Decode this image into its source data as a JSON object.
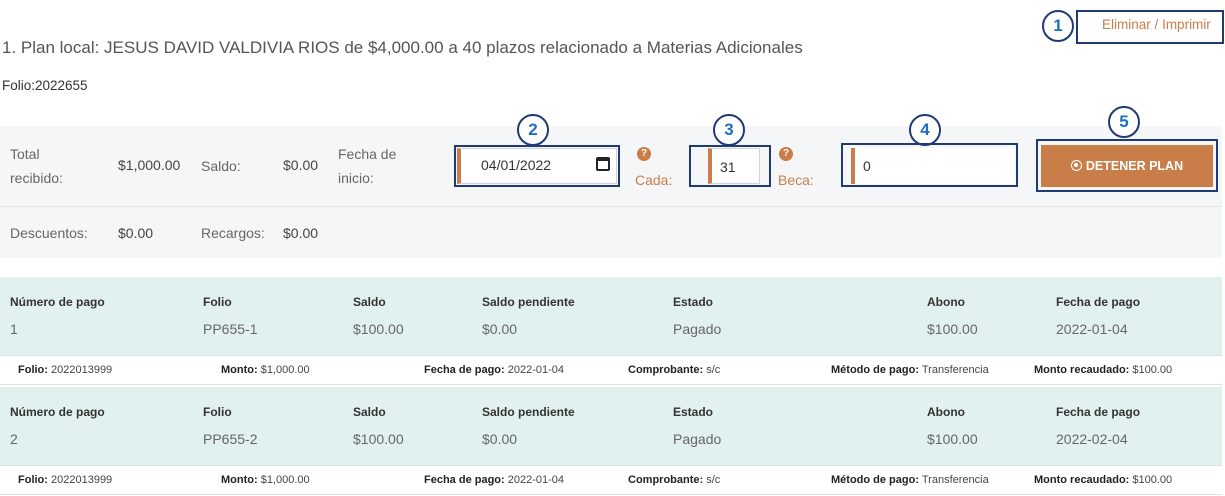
{
  "actions": {
    "delete_label": "Eliminar",
    "separator": "/",
    "print_label": "Imprimir"
  },
  "markers": [
    "1",
    "2",
    "3",
    "4",
    "5"
  ],
  "plan": {
    "title": "1. Plan local: JESUS DAVID VALDIVIA RIOS de $4,000.00 a 40 plazos relacionado a Materias Adicionales",
    "folio": "Folio:2022655"
  },
  "summary": {
    "total_label_1": "Total",
    "total_label_2": "recibido:",
    "total_value": "$1,000.00",
    "saldo_label": "Saldo:",
    "saldo_value": "$0.00",
    "fecha_label_1": "Fecha de",
    "fecha_label_2": "inicio:",
    "fecha_value": "04/01/2022",
    "cada_label": "Cada:",
    "cada_value": "31",
    "beca_label": "Beca:",
    "beca_value": "0",
    "help_glyph": "?",
    "stop_button": "DETENER PLAN",
    "descuentos_label": "Descuentos:",
    "descuentos_value": "$0.00",
    "recargos_label": "Recargos:",
    "recargos_value": "$0.00"
  },
  "table": {
    "headers": [
      "Número de pago",
      "Folio",
      "Saldo",
      "Saldo pendiente",
      "Estado",
      "Abono",
      "Fecha de pago"
    ],
    "detail_labels": [
      "Folio:",
      "Monto:",
      "Fecha de pago:",
      "Comprobante:",
      "Método de pago:",
      "Monto recaudado:"
    ],
    "payments": [
      {
        "values": [
          "1",
          "PP655-1",
          "$100.00",
          "$0.00",
          "Pagado",
          "$100.00",
          "2022-01-04"
        ],
        "details": [
          "2022013999",
          "$1,000.00",
          "2022-01-04",
          "s/c",
          "Transferencia",
          "$100.00"
        ]
      },
      {
        "values": [
          "2",
          "PP655-2",
          "$100.00",
          "$0.00",
          "Pagado",
          "$100.00",
          "2022-02-04"
        ],
        "details": [
          "2022013999",
          "$1,000.00",
          "2022-01-04",
          "s/c",
          "Transferencia",
          "$100.00"
        ]
      }
    ]
  },
  "colors": {
    "accent": "#c97e4a",
    "marker_border": "#1f3a75",
    "marker_text": "#1f6fc0",
    "row_bg": "#e1f1f0"
  }
}
